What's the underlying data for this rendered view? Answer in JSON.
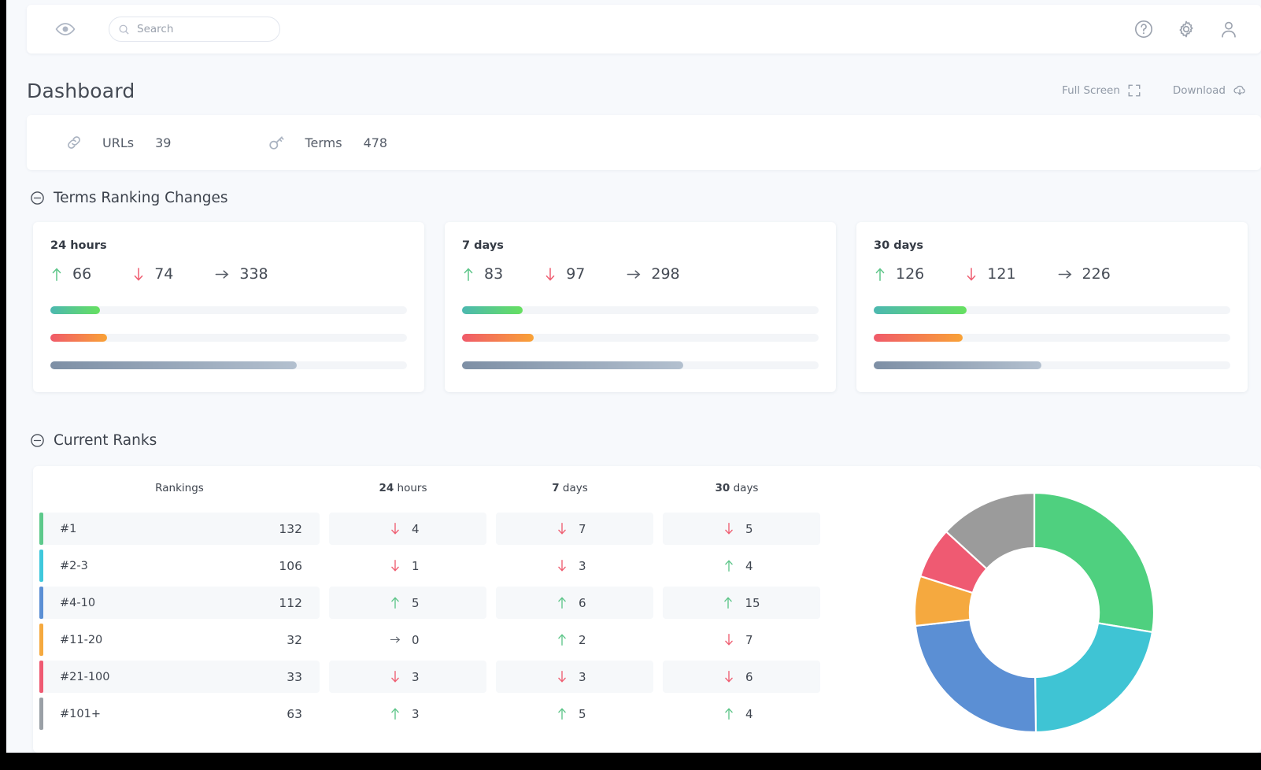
{
  "topbar": {
    "logo_icon": "eye-icon",
    "search": {
      "placeholder": "Search",
      "value": ""
    },
    "help_icon": "question-circle-icon",
    "settings_icon": "gear-icon",
    "account_icon": "user-icon"
  },
  "header": {
    "title": "Dashboard",
    "full_screen_label": "Full Screen",
    "download_label": "Download"
  },
  "stats": [
    {
      "icon": "link-icon",
      "label": "URLs",
      "value": "39"
    },
    {
      "icon": "key-icon",
      "label": "Terms",
      "value": "478"
    }
  ],
  "sections": {
    "ranking_changes": "Terms Ranking Changes",
    "current_ranks": "Current Ranks"
  },
  "ranking_cards": [
    {
      "title": "24 hours",
      "up": "66",
      "down": "74",
      "flat": "338",
      "bars": {
        "green_pct": 14,
        "red_pct": 16,
        "gray_pct": 69
      }
    },
    {
      "title": "7 days",
      "up": "83",
      "down": "97",
      "flat": "298",
      "bars": {
        "green_pct": 17,
        "red_pct": 20,
        "gray_pct": 62
      }
    },
    {
      "title": "30 days",
      "up": "126",
      "down": "121",
      "flat": "226",
      "bars": {
        "green_pct": 26,
        "red_pct": 25,
        "gray_pct": 47
      }
    }
  ],
  "ranks_table": {
    "columns": [
      {
        "key": "rankings",
        "label": "Rankings",
        "bold_prefix": ""
      },
      {
        "key": "h24",
        "label": " hours",
        "bold_prefix": "24"
      },
      {
        "key": "d7",
        "label": " days",
        "bold_prefix": "7"
      },
      {
        "key": "d30",
        "label": " days",
        "bold_prefix": "30"
      }
    ],
    "rows": [
      {
        "label": "#1",
        "count": "132",
        "color": "#5dc98b",
        "h24": {
          "dir": "down",
          "value": "4"
        },
        "d7": {
          "dir": "down",
          "value": "7"
        },
        "d30": {
          "dir": "down",
          "value": "5"
        }
      },
      {
        "label": "#2-3",
        "count": "106",
        "color": "#3fc8dc",
        "h24": {
          "dir": "down",
          "value": "1"
        },
        "d7": {
          "dir": "down",
          "value": "3"
        },
        "d30": {
          "dir": "up",
          "value": "4"
        }
      },
      {
        "label": "#4-10",
        "count": "112",
        "color": "#5b8fd4",
        "h24": {
          "dir": "up",
          "value": "5"
        },
        "d7": {
          "dir": "up",
          "value": "6"
        },
        "d30": {
          "dir": "up",
          "value": "15"
        }
      },
      {
        "label": "#11-20",
        "count": "32",
        "color": "#f5a93f",
        "h24": {
          "dir": "flat",
          "value": "0"
        },
        "d7": {
          "dir": "up",
          "value": "2"
        },
        "d30": {
          "dir": "down",
          "value": "7"
        }
      },
      {
        "label": "#21-100",
        "count": "33",
        "color": "#ef5a72",
        "h24": {
          "dir": "down",
          "value": "3"
        },
        "d7": {
          "dir": "down",
          "value": "3"
        },
        "d30": {
          "dir": "down",
          "value": "6"
        }
      },
      {
        "label": "#101+",
        "count": "63",
        "color": "#9aa0a6",
        "h24": {
          "dir": "up",
          "value": "3"
        },
        "d7": {
          "dir": "up",
          "value": "5"
        },
        "d30": {
          "dir": "up",
          "value": "4"
        }
      }
    ]
  },
  "chart_data": {
    "type": "pie",
    "title": "",
    "subtype": "donut",
    "labels": [
      "#1",
      "#2-3",
      "#4-10",
      "#11-20",
      "#21-100",
      "#101+"
    ],
    "values": [
      132,
      106,
      112,
      32,
      33,
      63
    ],
    "colors": [
      "#4fd07f",
      "#3fc4d4",
      "#5b8fd4",
      "#f5a93f",
      "#ef5a72",
      "#9b9b9b"
    ],
    "legend": "none",
    "total": 478,
    "start_angle_deg": -90,
    "inner_radius_ratio": 0.54
  }
}
